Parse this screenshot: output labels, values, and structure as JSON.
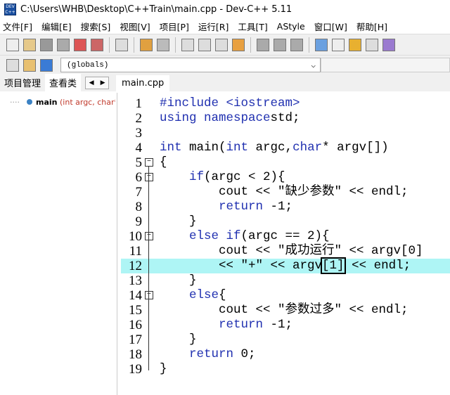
{
  "title": "C:\\Users\\WHB\\Desktop\\C++Train\\main.cpp - Dev-C++ 5.11",
  "menu": [
    "文件[F]",
    "编辑[E]",
    "搜索[S]",
    "视图[V]",
    "项目[P]",
    "运行[R]",
    "工具[T]",
    "AStyle",
    "窗口[W]",
    "帮助[H]"
  ],
  "scope_combo": "(globals)",
  "left_tabs": [
    "项目管理",
    "查看类"
  ],
  "file_tab": "main.cpp",
  "tree_item": {
    "name": "main",
    "sig": " (int argc, char* argv[])"
  },
  "highlight_line": 12,
  "code": [
    [
      [
        "kw",
        "#include <iostream>"
      ]
    ],
    [
      [
        "kw",
        "using namespace"
      ],
      [
        "",
        "std;"
      ]
    ],
    [],
    [
      [
        "kw",
        "int"
      ],
      [
        "",
        " main("
      ],
      [
        "kw",
        "int"
      ],
      [
        "",
        " argc,"
      ],
      [
        "kw",
        "char"
      ],
      [
        "",
        "* argv[])"
      ]
    ],
    [
      [
        "",
        "{"
      ]
    ],
    [
      [
        "",
        "    "
      ],
      [
        "kw",
        "if"
      ],
      [
        "",
        "(argc < 2){"
      ]
    ],
    [
      [
        "",
        "        cout << \"缺少参数\" << endl;"
      ]
    ],
    [
      [
        "",
        "        "
      ],
      [
        "kw",
        "return"
      ],
      [
        "",
        " -1;"
      ]
    ],
    [
      [
        "",
        "    }"
      ]
    ],
    [
      [
        "",
        "    "
      ],
      [
        "kw",
        "else if"
      ],
      [
        "",
        "(argc == 2){"
      ]
    ],
    [
      [
        "",
        "        cout << \"成功运行\" << argv[0]"
      ]
    ],
    [
      [
        "",
        "        << \"+\" << argv"
      ],
      [
        "cur",
        "[1]"
      ],
      [
        "",
        " << endl;"
      ]
    ],
    [
      [
        "",
        "    }"
      ]
    ],
    [
      [
        "",
        "    "
      ],
      [
        "kw",
        "else"
      ],
      [
        "",
        "{"
      ]
    ],
    [
      [
        "",
        "        cout << \"参数过多\" << endl;"
      ]
    ],
    [
      [
        "",
        "        "
      ],
      [
        "kw",
        "return"
      ],
      [
        "",
        " -1;"
      ]
    ],
    [
      [
        "",
        "    }"
      ]
    ],
    [
      [
        "",
        "    "
      ],
      [
        "kw",
        "return"
      ],
      [
        "",
        " 0;"
      ]
    ],
    [
      [
        "",
        "}"
      ]
    ]
  ],
  "folds": {
    "5": "-",
    "6": "-",
    "10": "-",
    "14": "-"
  }
}
